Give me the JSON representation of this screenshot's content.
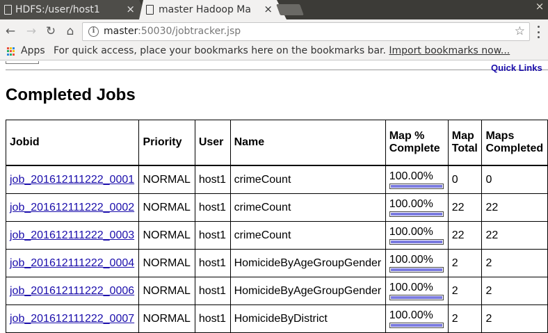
{
  "browser": {
    "tabs": [
      {
        "title": "HDFS:/user/host1",
        "close": "×"
      },
      {
        "title": "master Hadoop Ma",
        "close": "×"
      }
    ],
    "window_close": "×",
    "url_host": "master",
    "url_path": ":50030/jobtracker.jsp",
    "bookmarks": {
      "apps_label": "Apps",
      "hint": "For quick access, place your bookmarks here on the bookmarks bar.",
      "import_link": "Import bookmarks now..."
    },
    "icons": {
      "back": "arrow-left",
      "forward": "arrow-right",
      "reload": "reload",
      "home": "home",
      "info": "info",
      "star": "star",
      "menu": "kebab-menu"
    }
  },
  "page": {
    "quick_links": "Quick Links",
    "heading": "Completed Jobs",
    "progress_color": "#7b7be0",
    "columns": {
      "jobid": "Jobid",
      "priority": "Priority",
      "user": "User",
      "name": "Name",
      "map_pct_l1": "Map %",
      "map_pct_l2": "Complete",
      "map_total_l1": "Map",
      "map_total_l2": "Total",
      "maps_completed_l1": "Maps",
      "maps_completed_l2": "Completed"
    },
    "jobs": [
      {
        "jobid": "job_201612111222_0001",
        "priority": "NORMAL",
        "user": "host1",
        "name": "crimeCount",
        "map_pct": "100.00%",
        "map_fraction": 1.0,
        "map_total": "0",
        "maps_completed": "0"
      },
      {
        "jobid": "job_201612111222_0002",
        "priority": "NORMAL",
        "user": "host1",
        "name": "crimeCount",
        "map_pct": "100.00%",
        "map_fraction": 1.0,
        "map_total": "22",
        "maps_completed": "22"
      },
      {
        "jobid": "job_201612111222_0003",
        "priority": "NORMAL",
        "user": "host1",
        "name": "crimeCount",
        "map_pct": "100.00%",
        "map_fraction": 1.0,
        "map_total": "22",
        "maps_completed": "22"
      },
      {
        "jobid": "job_201612111222_0004",
        "priority": "NORMAL",
        "user": "host1",
        "name": "HomicideByAgeGroupGender",
        "map_pct": "100.00%",
        "map_fraction": 1.0,
        "map_total": "2",
        "maps_completed": "2"
      },
      {
        "jobid": "job_201612111222_0006",
        "priority": "NORMAL",
        "user": "host1",
        "name": "HomicideByAgeGroupGender",
        "map_pct": "100.00%",
        "map_fraction": 1.0,
        "map_total": "2",
        "maps_completed": "2"
      },
      {
        "jobid": "job_201612111222_0007",
        "priority": "NORMAL",
        "user": "host1",
        "name": "HomicideByDistrict",
        "map_pct": "100.00%",
        "map_fraction": 1.0,
        "map_total": "2",
        "maps_completed": "2"
      }
    ]
  }
}
